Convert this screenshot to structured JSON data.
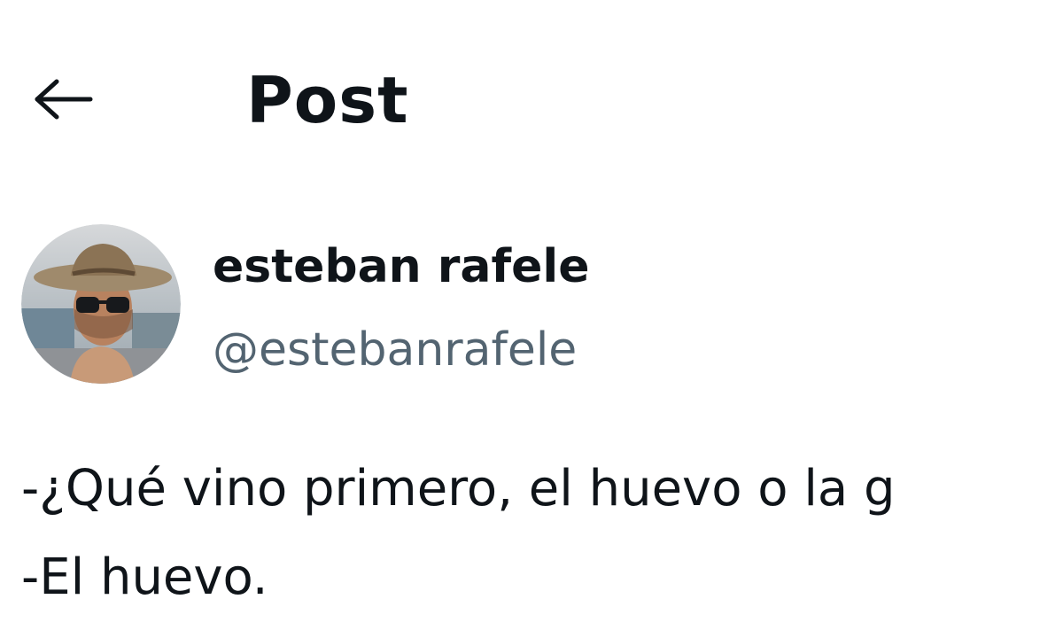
{
  "header": {
    "back_icon": "arrow-left-icon",
    "title": "Post"
  },
  "post": {
    "author": {
      "display_name": "esteban rafele",
      "handle": "@estebanrafele"
    },
    "text_lines": [
      "-¿Qué vino primero, el huevo o la g",
      "-El huevo."
    ]
  },
  "colors": {
    "text_primary": "#0f1419",
    "text_secondary": "#536471",
    "background": "#ffffff"
  }
}
